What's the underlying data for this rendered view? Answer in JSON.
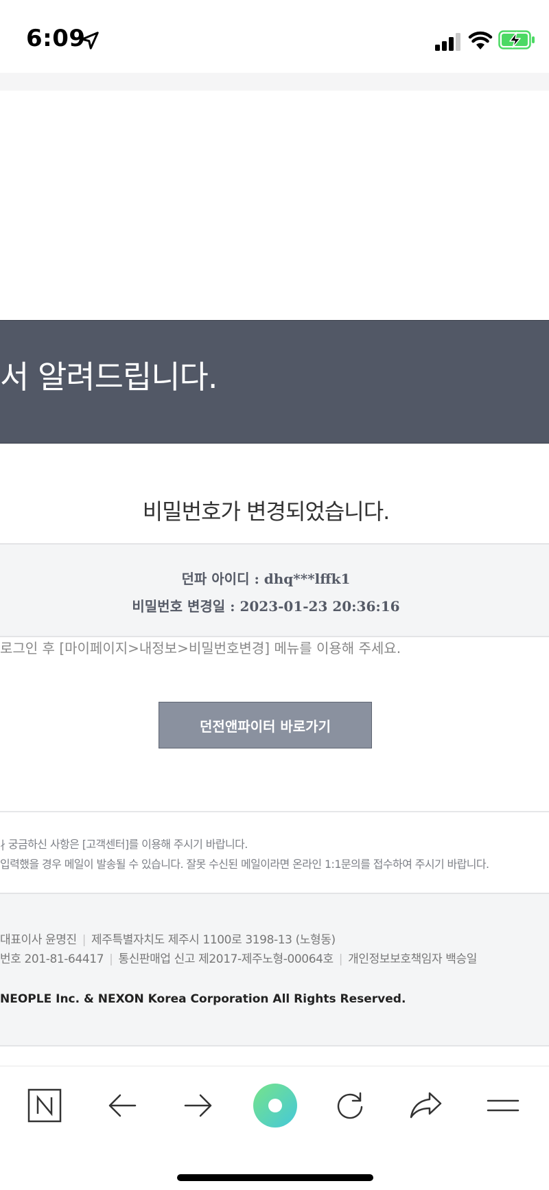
{
  "status_bar": {
    "time": "6:09",
    "icons": [
      "location-arrow-icon",
      "signal-icon",
      "wifi-icon",
      "battery-charging-icon"
    ],
    "battery_color": "#4cd964"
  },
  "email": {
    "banner_text": "서 알려드립니다.",
    "headline": "비밀번호가 변경되었습니다.",
    "info": {
      "id_line": "던파 아이디 : dhq***lffk1",
      "date_line": "비밀번호 변경일 : 2023-01-23 20:36:16"
    },
    "guide_text": "로그인 후 [마이페이지>내정보>비밀번호변경] 메뉴를 이용해 주세요.",
    "button_label": "던전앤파이터 바로가기",
    "notices": [
      "∤ 궁금하신 사항은 [고객센터]를 이용해 주시기 바랍니다.",
      "입력했을 경우 메일이 발송될 수 있습니다. 잘못 수신된 메일이라면 온라인 1:1문의를 접수하여 주시기 바랍니다."
    ],
    "footer": {
      "line1": [
        "대표이사 윤명진",
        "제주특별자치도 제주시 1100로 3198-13 (노형동)"
      ],
      "line2": [
        "번호 201-81-64417",
        "통신판매업 신고 제2017-제주노형-00064호",
        "개인정보보호책임자 백승일"
      ],
      "copyright": "NEOPLE Inc. & NEXON Korea Corporation All Rights Reserved."
    },
    "colors": {
      "banner_bg": "#525866",
      "button_bg": "#8a919f",
      "info_bg": "#f4f5f6"
    }
  },
  "toolbar": {
    "items": [
      "naver-home-icon",
      "back-arrow-icon",
      "forward-arrow-icon",
      "green-dot-icon",
      "refresh-icon",
      "share-icon",
      "menu-icon"
    ],
    "accent_color": "#5ed9a3"
  }
}
